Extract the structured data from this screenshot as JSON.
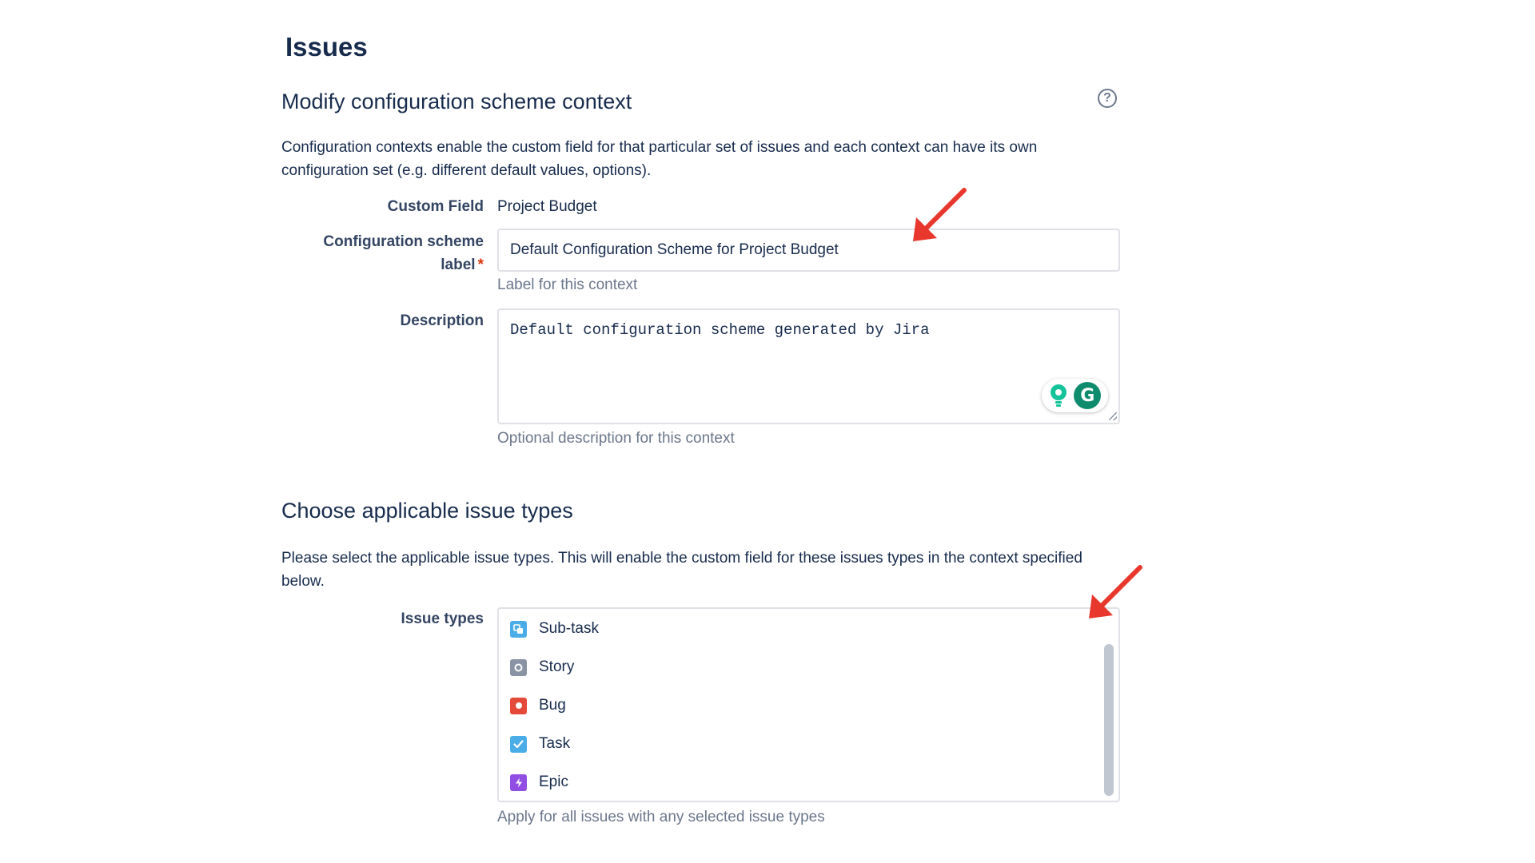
{
  "page": {
    "title": "Issues"
  },
  "context_section": {
    "title": "Modify configuration scheme context",
    "description": "Configuration contexts enable the custom field for that particular set of issues and each context can have its own configuration set (e.g. different default values, options)."
  },
  "form": {
    "custom_field": {
      "label": "Custom Field",
      "value": "Project Budget"
    },
    "scheme_label": {
      "label": "Configuration scheme label",
      "required_mark": "*",
      "value": "Default Configuration Scheme for Project Budget",
      "hint": "Label for this context"
    },
    "description": {
      "label": "Description",
      "value": "Default configuration scheme generated by Jira",
      "hint": "Optional description for this context"
    }
  },
  "issue_types_section": {
    "title": "Choose applicable issue types",
    "description": "Please select the applicable issue types. This will enable the custom field for these issues types in the context specified below.",
    "label": "Issue types",
    "hint": "Apply for all issues with any selected issue types",
    "items": [
      {
        "label": "Sub-task",
        "icon": "subtask-icon",
        "color": "#4bade8"
      },
      {
        "label": "Story",
        "icon": "story-icon",
        "color": "#8993a4"
      },
      {
        "label": "Bug",
        "icon": "bug-icon",
        "color": "#e5493a"
      },
      {
        "label": "Task",
        "icon": "task-icon",
        "color": "#4bade8"
      },
      {
        "label": "Epic",
        "icon": "epic-icon",
        "color": "#904ee2"
      }
    ]
  },
  "annotations": {
    "arrow_color": "#e8372c"
  }
}
